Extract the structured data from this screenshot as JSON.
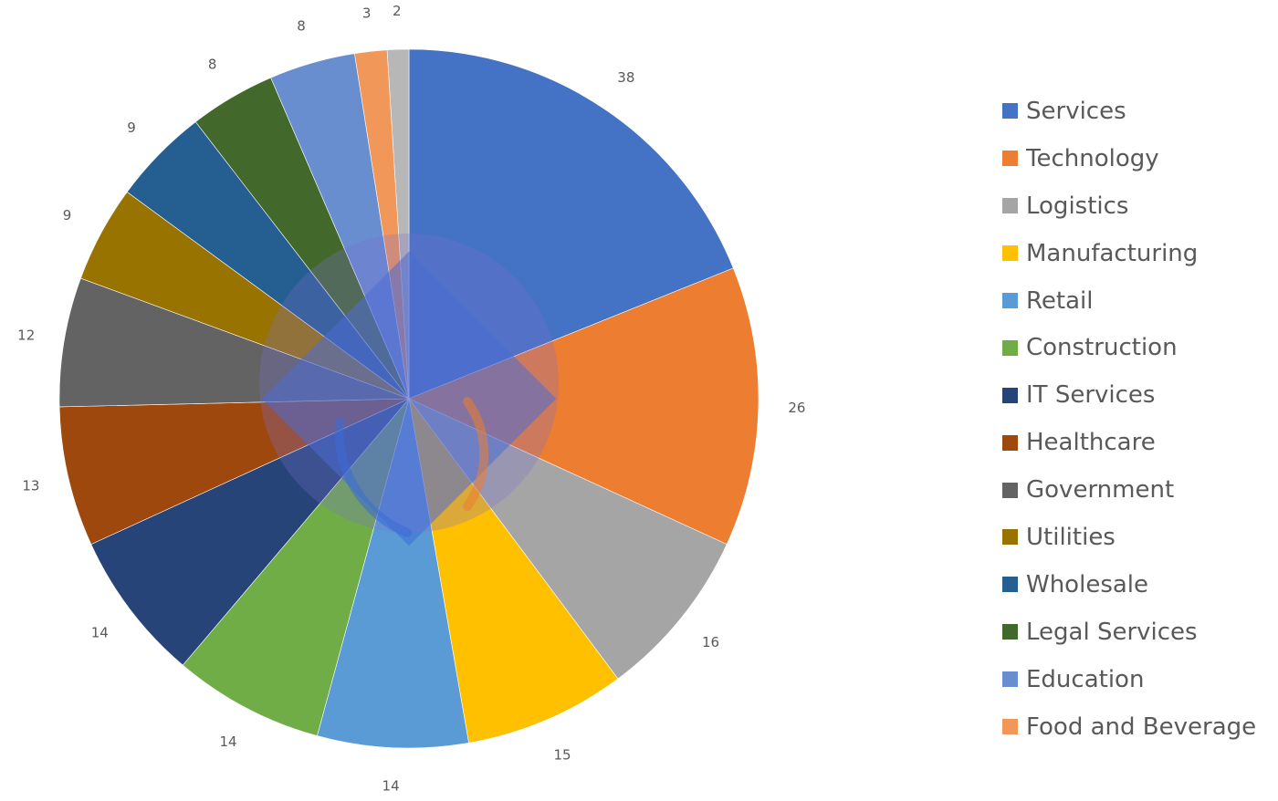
{
  "chart_data": {
    "type": "pie",
    "title": "",
    "start": "top",
    "direction": "clockwise",
    "show_data_labels": true,
    "legend_position": "right",
    "slices": [
      {
        "label": "Services",
        "value": 38,
        "color": "#4472C4"
      },
      {
        "label": "Technology",
        "value": 26,
        "color": "#ED7D31"
      },
      {
        "label": "Logistics",
        "value": 16,
        "color": "#A5A5A5"
      },
      {
        "label": "Manufacturing",
        "value": 15,
        "color": "#FFC000"
      },
      {
        "label": "Retail",
        "value": 14,
        "color": "#5B9BD5"
      },
      {
        "label": "Construction",
        "value": 14,
        "color": "#70AD47"
      },
      {
        "label": "IT Services",
        "value": 14,
        "color": "#264478"
      },
      {
        "label": "Healthcare",
        "value": 13,
        "color": "#9E480E"
      },
      {
        "label": "Government",
        "value": 12,
        "color": "#636363"
      },
      {
        "label": "Utilities",
        "value": 9,
        "color": "#997300"
      },
      {
        "label": "Wholesale",
        "value": 9,
        "color": "#255E91"
      },
      {
        "label": "Legal Services",
        "value": 8,
        "color": "#43682B"
      },
      {
        "label": "Education",
        "value": 8,
        "color": "#698ED0"
      },
      {
        "label": "Food and Beverage",
        "value": 3,
        "color": "#F1975A"
      },
      {
        "label": "",
        "value": 2,
        "color": "#B7B7B7"
      }
    ],
    "legend": [
      "Services",
      "Technology",
      "Logistics",
      "Manufacturing",
      "Retail",
      "Construction",
      "IT Services",
      "Healthcare",
      "Government",
      "Utilities",
      "Wholesale",
      "Legal Services",
      "Education",
      "Food and Beverage"
    ]
  }
}
